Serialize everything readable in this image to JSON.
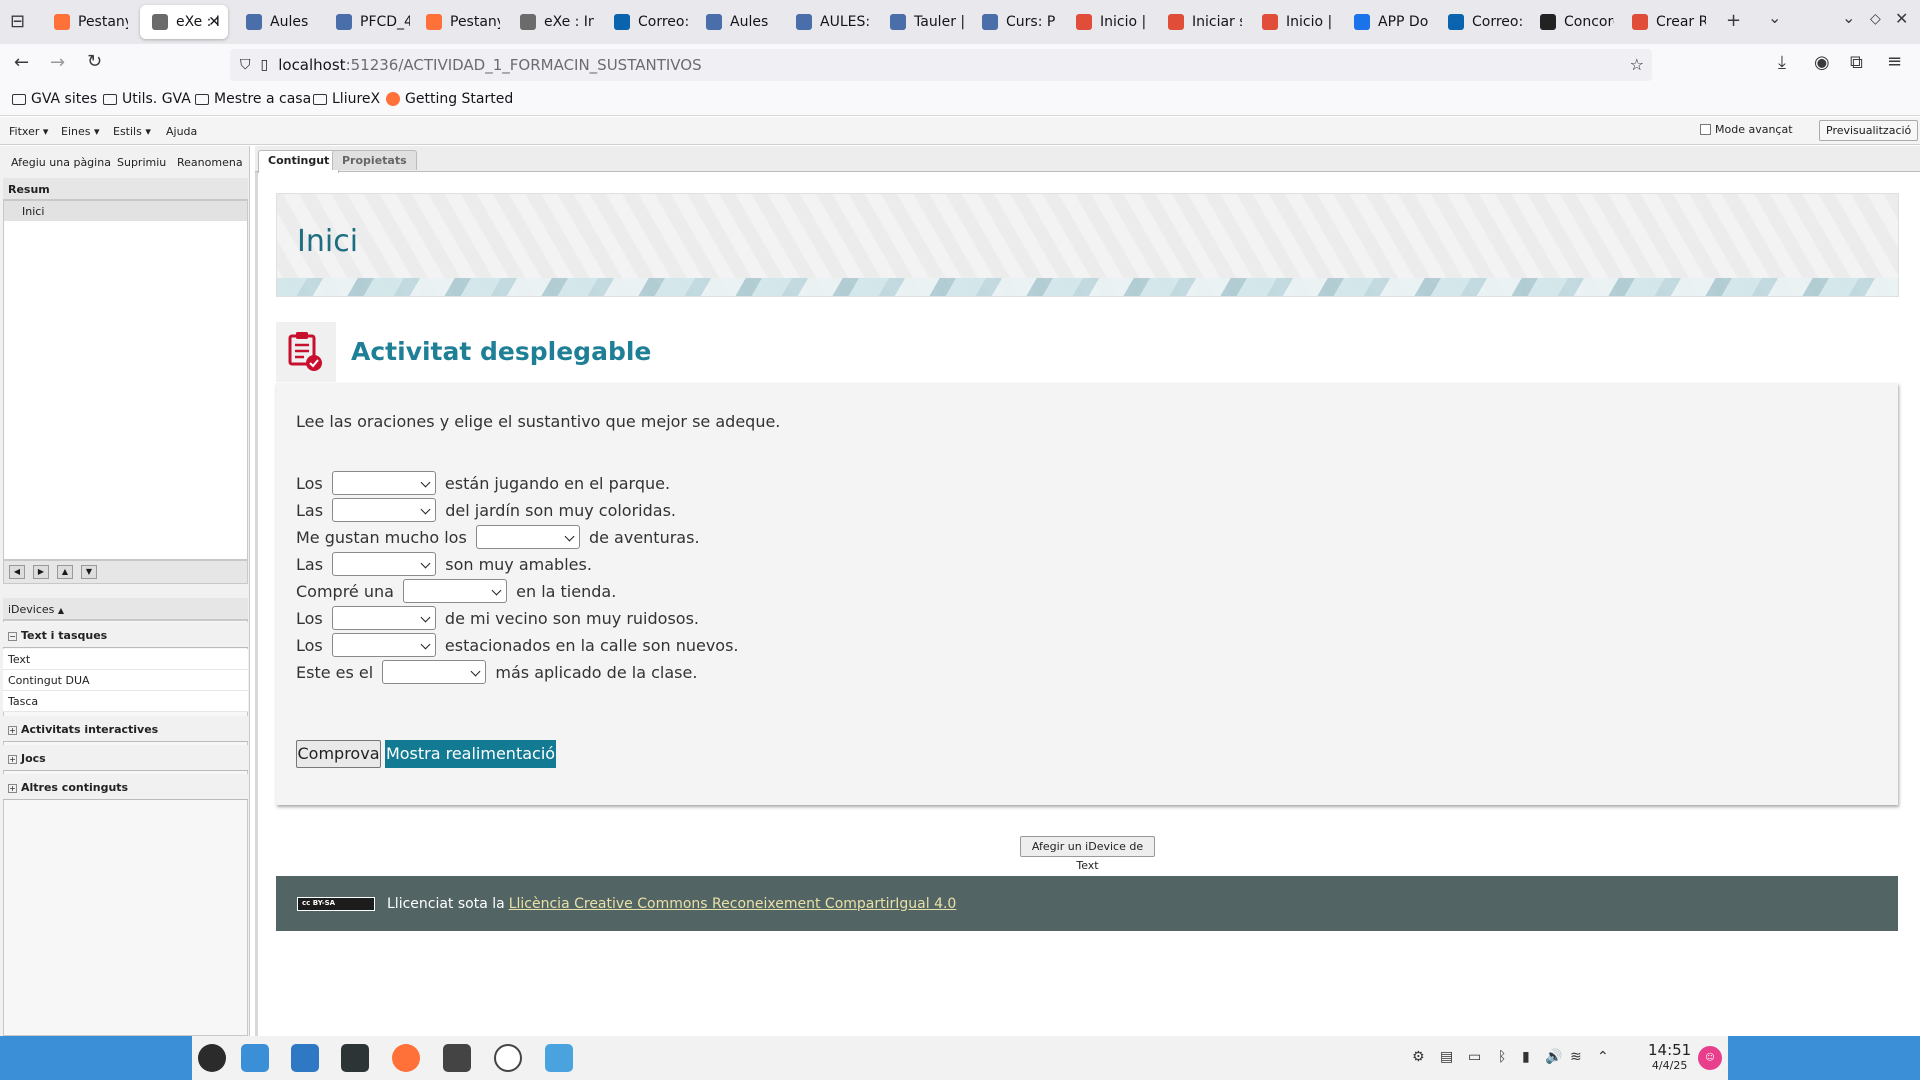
{
  "browser": {
    "tabs": [
      {
        "label": "Pestany",
        "color": "#ff7139"
      },
      {
        "label": "eXe : I",
        "color": "#6b6b6b",
        "active": true
      },
      {
        "label": "Aules",
        "color": "#4a6ea9"
      },
      {
        "label": "PFCD_4",
        "color": "#4a6ea9"
      },
      {
        "label": "Pestany",
        "color": "#ff7139"
      },
      {
        "label": "eXe : Ini",
        "color": "#6b6b6b"
      },
      {
        "label": "Correo:",
        "color": "#0a64ad"
      },
      {
        "label": "Aules",
        "color": "#4a6ea9"
      },
      {
        "label": "AULES: I",
        "color": "#4a6ea9"
      },
      {
        "label": "Tauler |",
        "color": "#4a6ea9"
      },
      {
        "label": "Curs: PF",
        "color": "#4a6ea9"
      },
      {
        "label": "Inicio |",
        "color": "#e04e39"
      },
      {
        "label": "Iniciar s",
        "color": "#e04e39"
      },
      {
        "label": "Inicio |",
        "color": "#e04e39"
      },
      {
        "label": "APP Doc",
        "color": "#1a73e8"
      },
      {
        "label": "Correo:",
        "color": "#0a64ad"
      },
      {
        "label": "Concorc",
        "color": "#222222"
      },
      {
        "label": "Crear Re",
        "color": "#e04e39"
      }
    ],
    "url_host": "localhost",
    "url_path": ":51236/ACTIVIDAD_1_FORMACIN_SUSTANTIVOS",
    "bookmarks": [
      "GVA sites",
      "Utils. GVA",
      "Mestre a casa",
      "LliureX",
      "Getting Started"
    ]
  },
  "exe": {
    "menu": [
      "Fitxer",
      "Eines",
      "Estils",
      "Ajuda"
    ],
    "advanced_mode_label": "Mode avançat",
    "preview_label": "Previsualització",
    "outline_toolbar": [
      "Afegiu una pàgina",
      "Suprimiu",
      "Reanomena"
    ],
    "outline_header": "Resum",
    "outline_nodes": [
      "Inici"
    ],
    "idevices_header": "iDevices",
    "idevice_categories": [
      {
        "label": "Text i tasques",
        "expanded": true,
        "items": [
          "Text",
          "Contingut DUA",
          "Tasca"
        ]
      },
      {
        "label": "Activitats interactives",
        "expanded": false
      },
      {
        "label": "Jocs",
        "expanded": false
      },
      {
        "label": "Altres continguts",
        "expanded": false
      }
    ],
    "content_tabs": [
      "Contingut",
      "Propietats"
    ],
    "add_text_idevice_label": "Afegir un iDevice de Text"
  },
  "page": {
    "title": "Inici",
    "activity": {
      "title": "Activitat desplegable",
      "instructions": "Lee las oraciones y elige el sustantivo que mejor se adeque.",
      "sentences": [
        {
          "before": "Los ",
          "after": " están jugando en el parque."
        },
        {
          "before": "Las ",
          "after": " del jardín son muy coloridas."
        },
        {
          "before": "Me gustan mucho los ",
          "after": " de aventuras."
        },
        {
          "before": "Las ",
          "after": " son muy amables."
        },
        {
          "before": "Compré una ",
          "after": " en la tienda."
        },
        {
          "before": "Los ",
          "after": " de mi vecino son muy ruidosos."
        },
        {
          "before": "Los ",
          "after": " estacionados en la calle son nuevos."
        },
        {
          "before": "Este es el ",
          "after": " más aplicado de la clase."
        }
      ],
      "check_label": "Comprova",
      "feedback_label": "Mostra realimentació"
    },
    "license": {
      "badge": "cc BY-SA",
      "prefix": "Llicenciat sota la",
      "link_text": "Llicència Creative Commons Reconeixement CompartirIgual 4.0"
    },
    "colors": {
      "title": "#1e6d80",
      "activity_title": "#1e7f96",
      "feedback_button": "#137a93",
      "footer": "#536465"
    }
  },
  "taskbar": {
    "time": "14:51",
    "date": "4/4/25"
  }
}
